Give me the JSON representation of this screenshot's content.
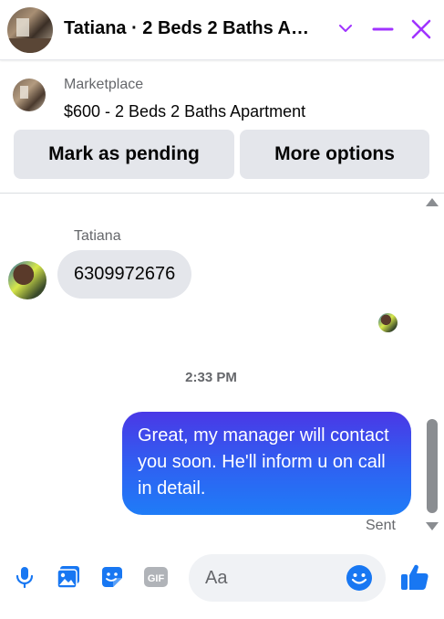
{
  "header": {
    "title": "Tatiana · 2 Beds 2 Baths A…",
    "accent_color": "#a033ff"
  },
  "marketplace": {
    "label": "Marketplace",
    "listing": "$600 - 2 Beds 2 Baths Apartment",
    "mark_pending_label": "Mark as pending",
    "more_options_label": "More options"
  },
  "thread": {
    "sender_name": "Tatiana",
    "incoming_message": "6309972676",
    "timestamp": "2:33 PM",
    "outgoing_message": "Great, my manager will contact you soon. He'll inform u on call in detail.",
    "status": "Sent"
  },
  "composer": {
    "placeholder": "Aa",
    "icons": [
      "mic-icon",
      "image-icon",
      "sticker-icon",
      "gif-icon",
      "emoji-icon",
      "like-icon"
    ],
    "icon_color": "#1877f2"
  }
}
